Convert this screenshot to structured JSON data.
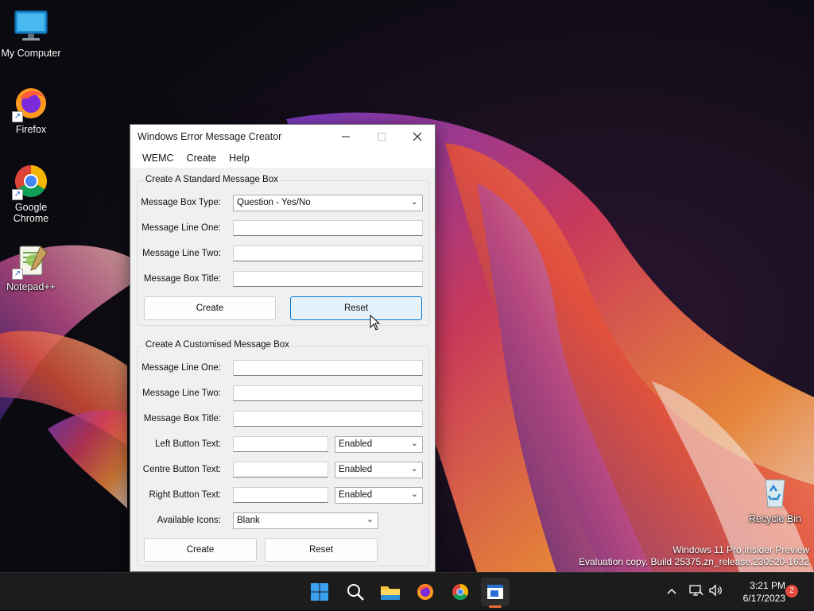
{
  "desktop": {
    "icons": [
      {
        "label": "My Computer"
      },
      {
        "label": "Firefox"
      },
      {
        "label": "Google Chrome"
      },
      {
        "label": "Notepad++"
      },
      {
        "label": "Recycle Bin"
      }
    ],
    "watermark": {
      "line1": "Windows 11 Pro Insider Preview",
      "line2": "Evaluation copy. Build 25375.zn_release.230520-1632"
    }
  },
  "window": {
    "title": "Windows Error Message Creator",
    "menu": [
      "WEMC",
      "Create",
      "Help"
    ],
    "standard": {
      "title": "Create A Standard Message Box",
      "type_label": "Message Box Type:",
      "type_value": "Question - Yes/No",
      "line_one_label": "Message Line One:",
      "line_one_value": "",
      "line_two_label": "Message Line Two:",
      "line_two_value": "",
      "box_title_label": "Message Box Title:",
      "box_title_value": "",
      "create_label": "Create",
      "reset_label": "Reset"
    },
    "custom": {
      "title": "Create A Customised Message Box",
      "line_one_label": "Message Line One:",
      "line_two_label": "Message Line Two:",
      "box_title_label": "Message Box Title:",
      "left_button_label": "Left Button Text:",
      "left_button_state": "Enabled",
      "centre_button_label": "Centre Button Text:",
      "centre_button_state": "Enabled",
      "right_button_label": "Right Button Text:",
      "right_button_state": "Enabled",
      "icons_label": "Available Icons:",
      "icons_value": "Blank",
      "create_label": "Create",
      "reset_label": "Reset"
    }
  },
  "taskbar": {
    "icons": [
      "start-icon",
      "search-icon",
      "file-explorer-icon",
      "firefox-icon",
      "chrome-icon",
      "wemc-app-icon"
    ],
    "time": "3:21 PM",
    "date": "6/17/2023",
    "notifications": "2"
  },
  "colors": {
    "accent": "#0078d7",
    "taskbar": "#1c1c1c",
    "window_bg": "#f0f0f0",
    "badge": "#e64a3b"
  }
}
